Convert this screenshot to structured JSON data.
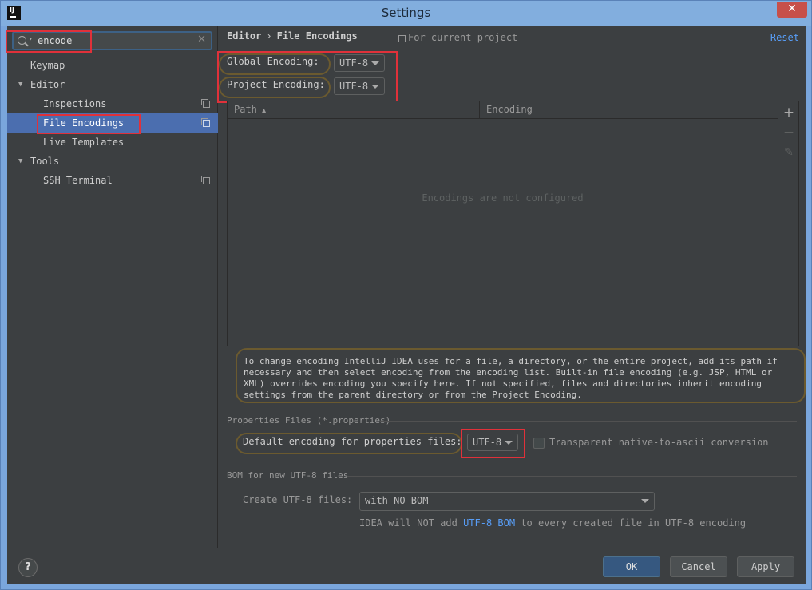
{
  "window": {
    "title": "Settings",
    "close": "✕",
    "app_icon": "IJ"
  },
  "search": {
    "value": "encode",
    "clear": "✕"
  },
  "sidebar": {
    "items": [
      {
        "label": "Keymap"
      },
      {
        "label": "Editor",
        "arrow": "▼"
      },
      {
        "label": "Inspections"
      },
      {
        "label": "File Encodings"
      },
      {
        "label": "Live Templates"
      },
      {
        "label": "Tools",
        "arrow": "▼"
      },
      {
        "label": "SSH Terminal"
      }
    ]
  },
  "header": {
    "crumb_parent": "Editor",
    "crumb_sep": "›",
    "crumb_current": "File Encodings",
    "scope": "For current project",
    "reset": "Reset"
  },
  "encodings": {
    "global_label": "Global Encoding:",
    "global_value": "UTF-8",
    "project_label": "Project Encoding:",
    "project_value": "UTF-8"
  },
  "table": {
    "columns": [
      "Path",
      "Encoding"
    ],
    "sort": "▲",
    "empty": "Encodings are not configured",
    "tools": {
      "add": "+",
      "remove": "−",
      "edit": "✎"
    }
  },
  "info": "To change encoding IntelliJ IDEA uses for a file, a directory, or the entire project, add its path if necessary and then select encoding from the encoding list. Built-in file encoding (e.g. JSP, HTML or XML) overrides encoding you specify here. If not specified, files and directories inherit encoding settings from the parent directory or from the Project Encoding.",
  "properties": {
    "section": "Properties Files (*.properties)",
    "default_label": "Default encoding for properties files:",
    "default_value": "UTF-8",
    "transparent_label": "Transparent native-to-ascii conversion",
    "transparent_checked": false
  },
  "bom": {
    "section": "BOM for new UTF-8 files",
    "create_label": "Create UTF-8 files:",
    "create_value": "with NO BOM",
    "note_prefix": "IDEA will NOT add",
    "note_link": "UTF-8 BOM",
    "note_suffix": "to every created file in UTF-8 encoding"
  },
  "buttons": {
    "help": "?",
    "ok": "OK",
    "cancel": "Cancel",
    "apply": "Apply"
  },
  "colors": {
    "selection": "#4b6eaf",
    "highlight_box": "#e0313a",
    "oval": "#6b5a2f",
    "link": "#589df6"
  }
}
